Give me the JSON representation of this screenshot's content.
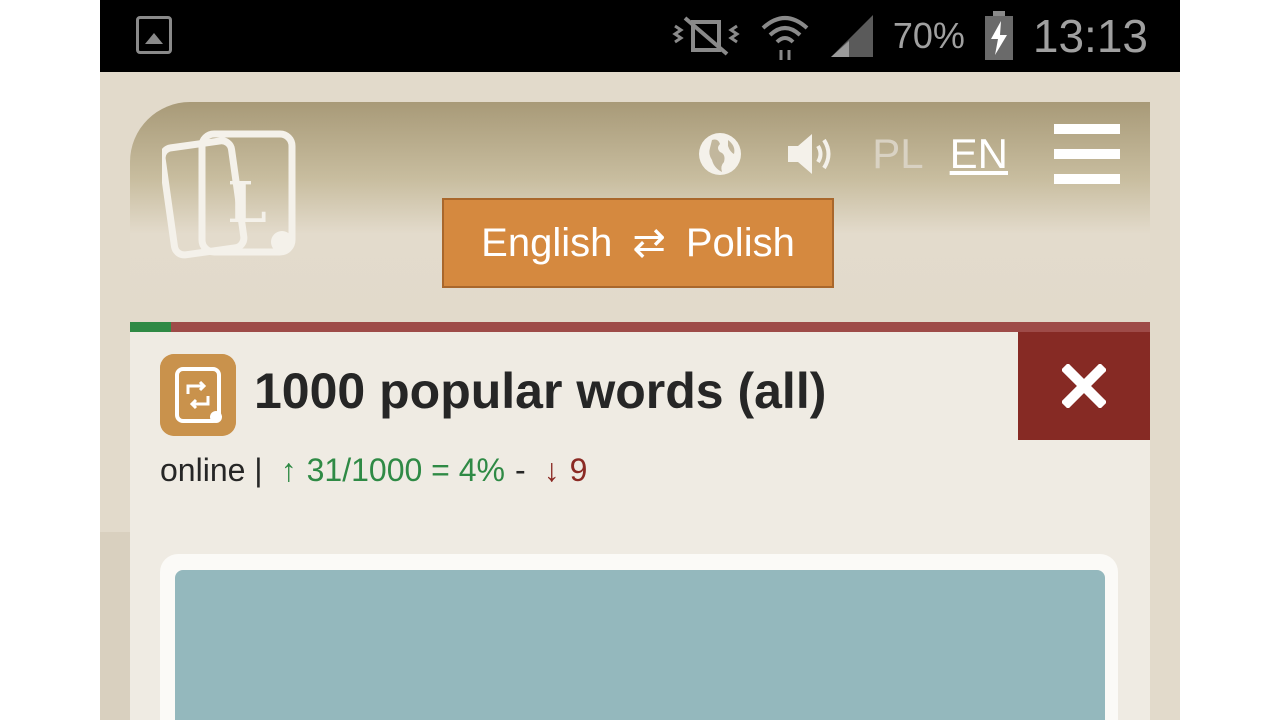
{
  "status_bar": {
    "battery_percent": "70%",
    "time": "13:13",
    "icons": [
      "gallery-notification-icon",
      "vibrate-mute-icon",
      "wifi-icon",
      "signal-icon",
      "battery-charging-icon"
    ]
  },
  "header": {
    "logo_letter": "L",
    "languages": {
      "pl": "PL",
      "en": "EN",
      "active": "EN"
    },
    "icons": [
      "globe-icon",
      "speaker-icon",
      "menu-icon"
    ],
    "direction_button": {
      "from": "English",
      "swap_symbol": "⇄",
      "to": "Polish"
    }
  },
  "progress": {
    "fraction": 0.04,
    "fill_color": "#2f8a45",
    "rest_color": "#9e4b48"
  },
  "card": {
    "title": "1000 popular words (all)",
    "stats": {
      "mode": "online |",
      "up_arrow": "↑",
      "known": "31/1000 = 4%",
      "separator": "-",
      "down_arrow": "↓",
      "wrong": "9"
    },
    "close_symbol": "✖"
  },
  "colors": {
    "accent": "#d5893f",
    "danger": "#862a24",
    "success": "#2f8a45",
    "image_bg": "#94b8bd"
  }
}
